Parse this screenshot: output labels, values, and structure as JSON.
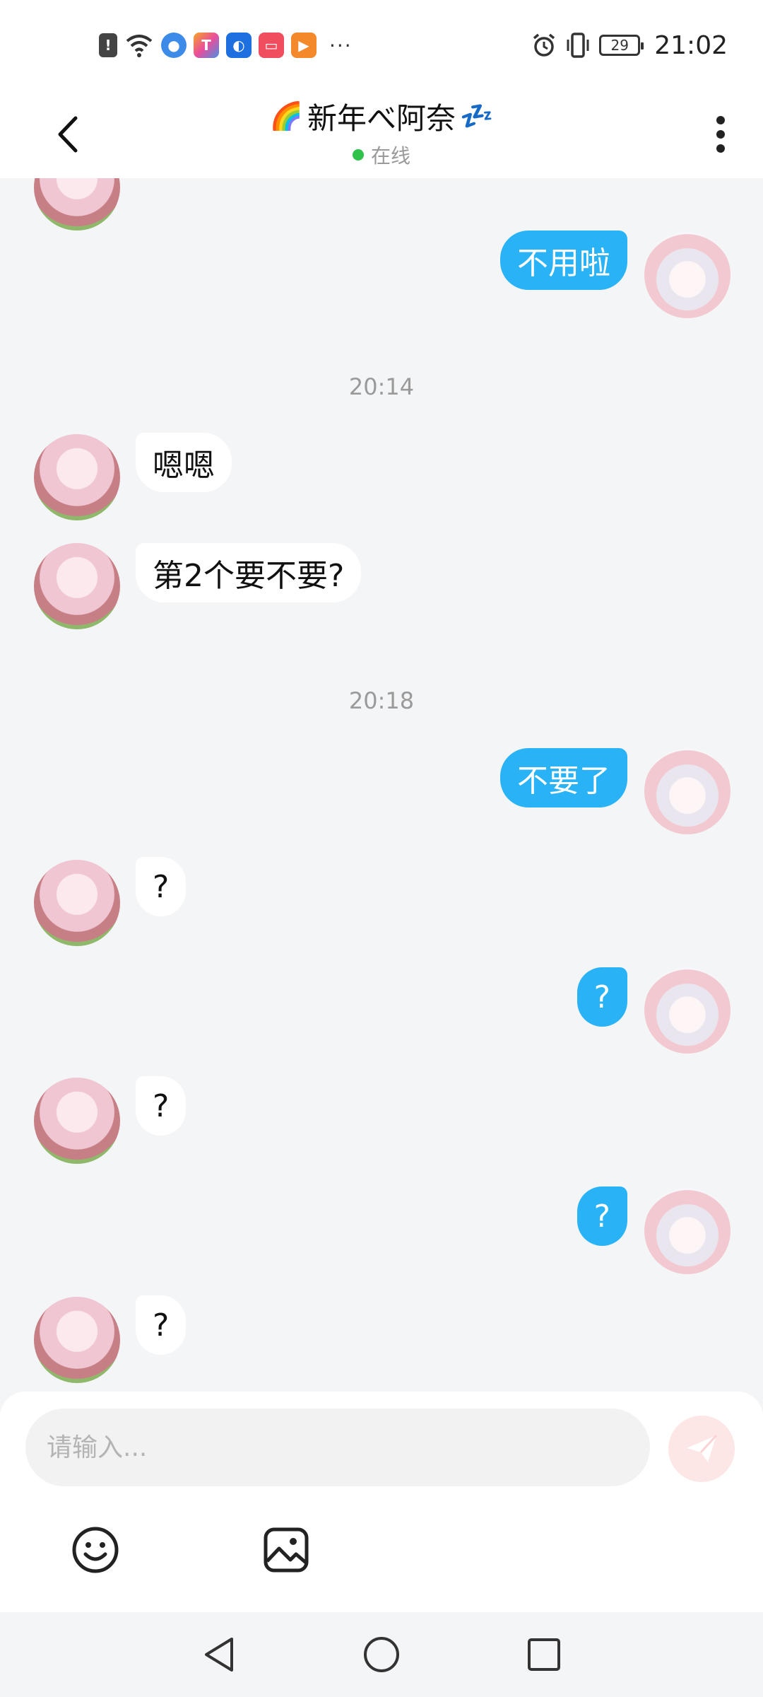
{
  "status_bar": {
    "time": "21:02",
    "battery": "29",
    "more_indicator": "···",
    "left_icons": [
      "alert-icon",
      "wifi-icon",
      "browser-app-icon",
      "tool-app-icon",
      "idea-app-icon",
      "book-app-icon",
      "video-app-icon"
    ],
    "right_icons": [
      "alarm-icon",
      "vibrate-icon",
      "battery-icon"
    ]
  },
  "header": {
    "title": "新年べ阿奈",
    "title_prefix_emoji": "🌈",
    "title_suffix_emoji": "💤",
    "status": "在线"
  },
  "chat": {
    "messages": [
      {
        "side": "out",
        "text": "不用啦"
      },
      {
        "type": "time",
        "text": "20:14"
      },
      {
        "side": "in",
        "text": "嗯嗯"
      },
      {
        "side": "in",
        "text": "第2个要不要?"
      },
      {
        "type": "time",
        "text": "20:18"
      },
      {
        "side": "out",
        "text": "不要了"
      },
      {
        "side": "in",
        "text": "?"
      },
      {
        "side": "out",
        "text": "?"
      },
      {
        "side": "in",
        "text": "?"
      },
      {
        "side": "out",
        "text": "?"
      },
      {
        "side": "in",
        "text": "?"
      }
    ]
  },
  "input": {
    "placeholder": "请输入..."
  },
  "colors": {
    "outgoing_bubble": "#29b3f6",
    "incoming_bubble": "#ffffff",
    "online_dot": "#2fc24a",
    "send_button": "#fde6e6",
    "background": "#f4f5f7"
  }
}
